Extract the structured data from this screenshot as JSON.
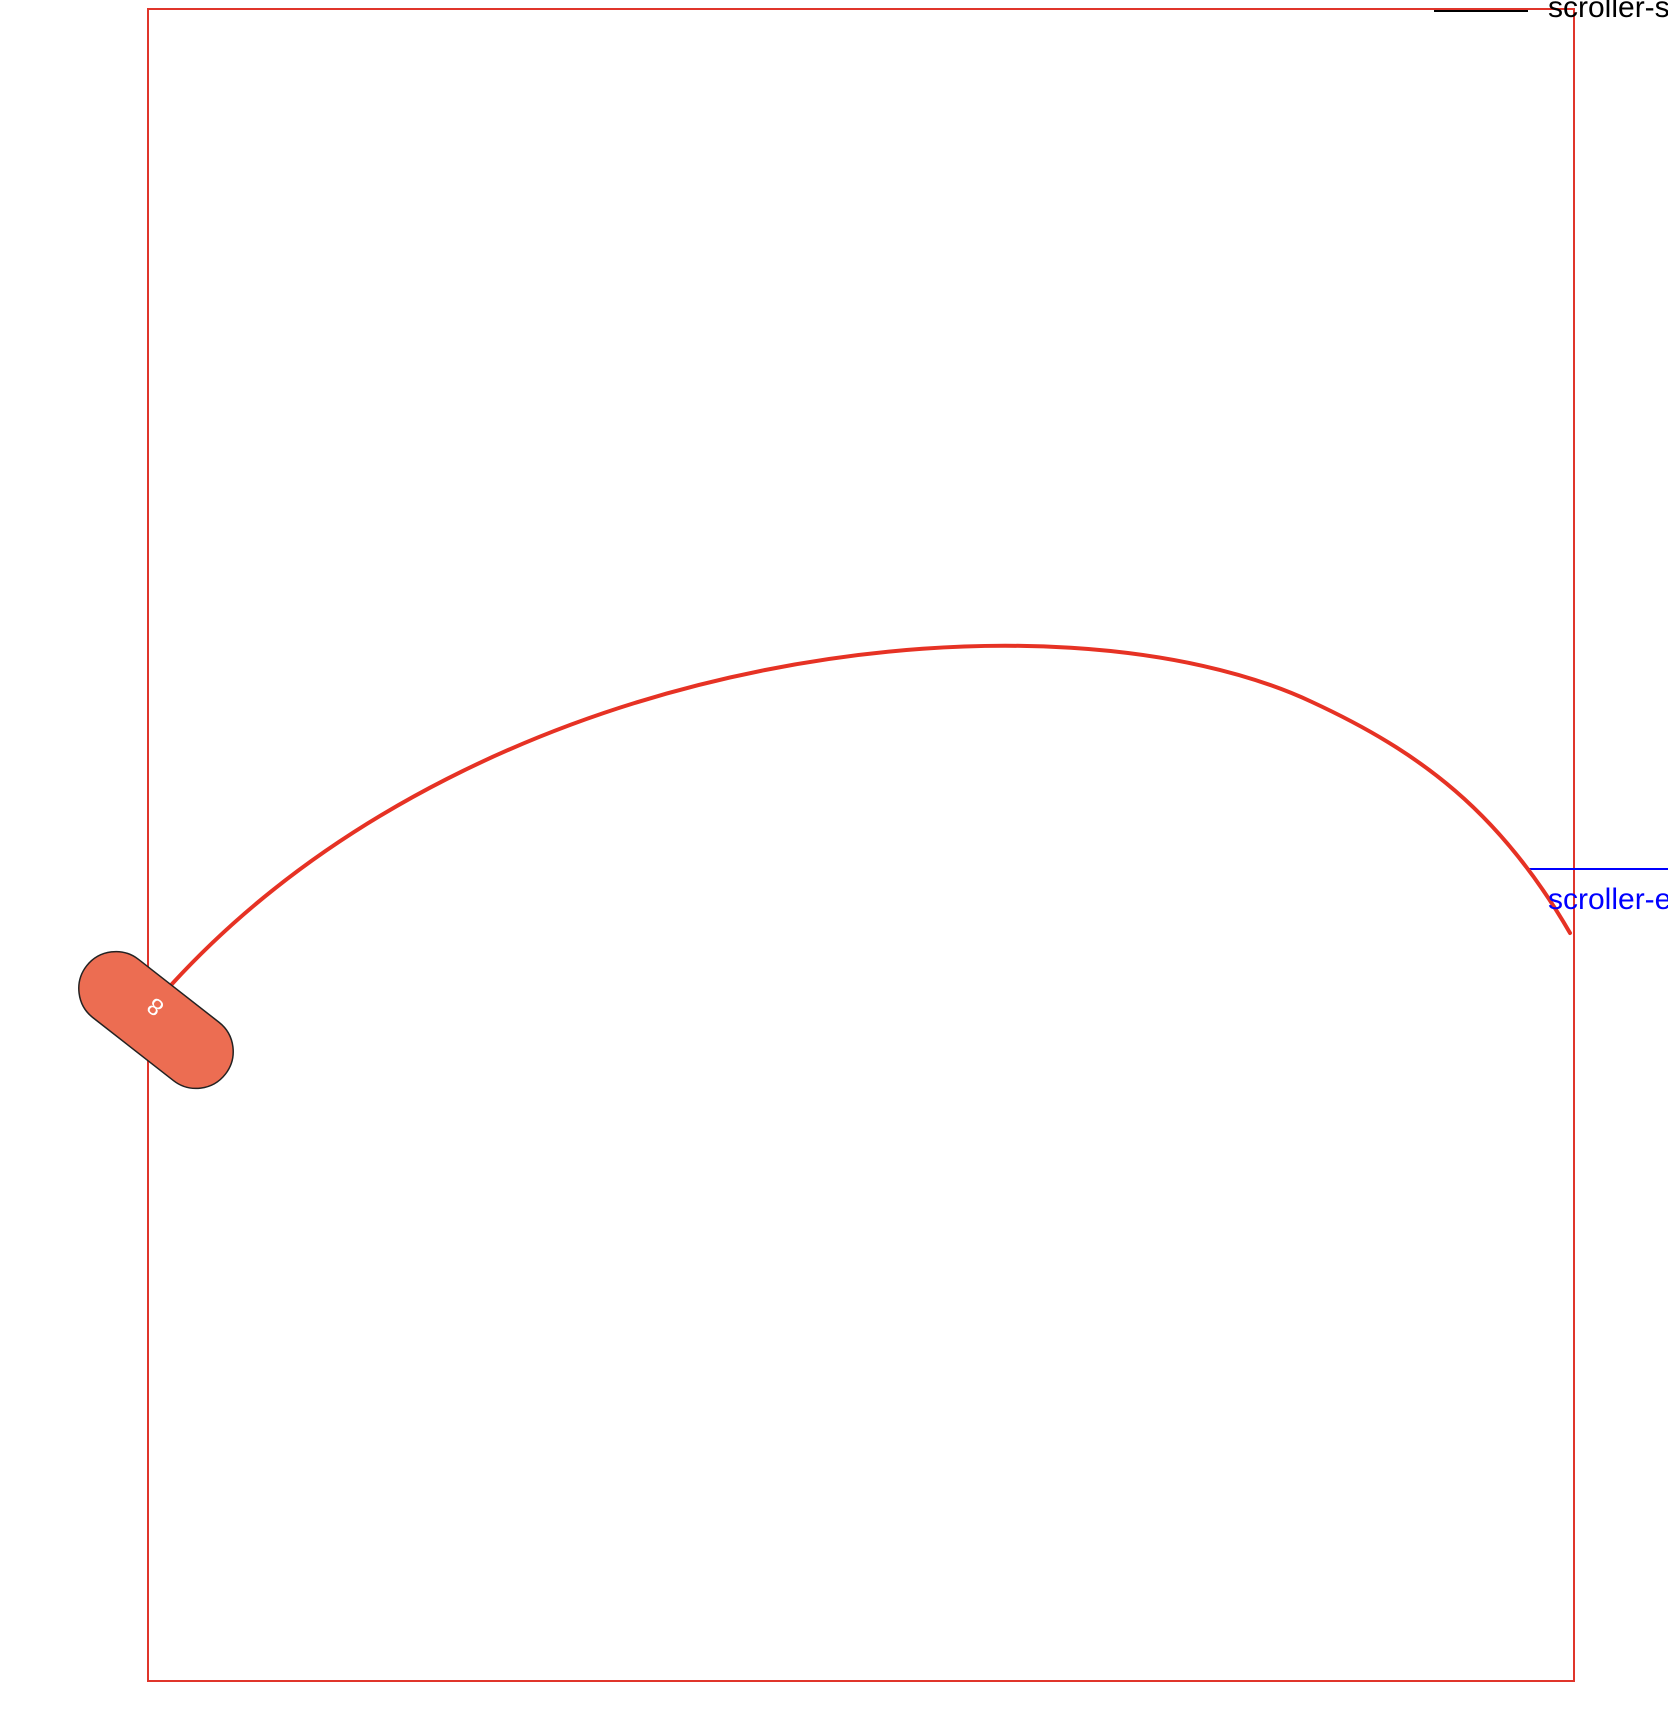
{
  "scroller": {
    "start_label": "scroller-s",
    "end_label": "scroller-e"
  },
  "pill": {
    "label": "8"
  },
  "colors": {
    "frame": "#e0352b",
    "curve": "#e63224",
    "pill_fill": "#ec6d52",
    "pill_stroke": "#222222",
    "start_marker": "#000000",
    "end_marker": "#0000ff"
  }
}
